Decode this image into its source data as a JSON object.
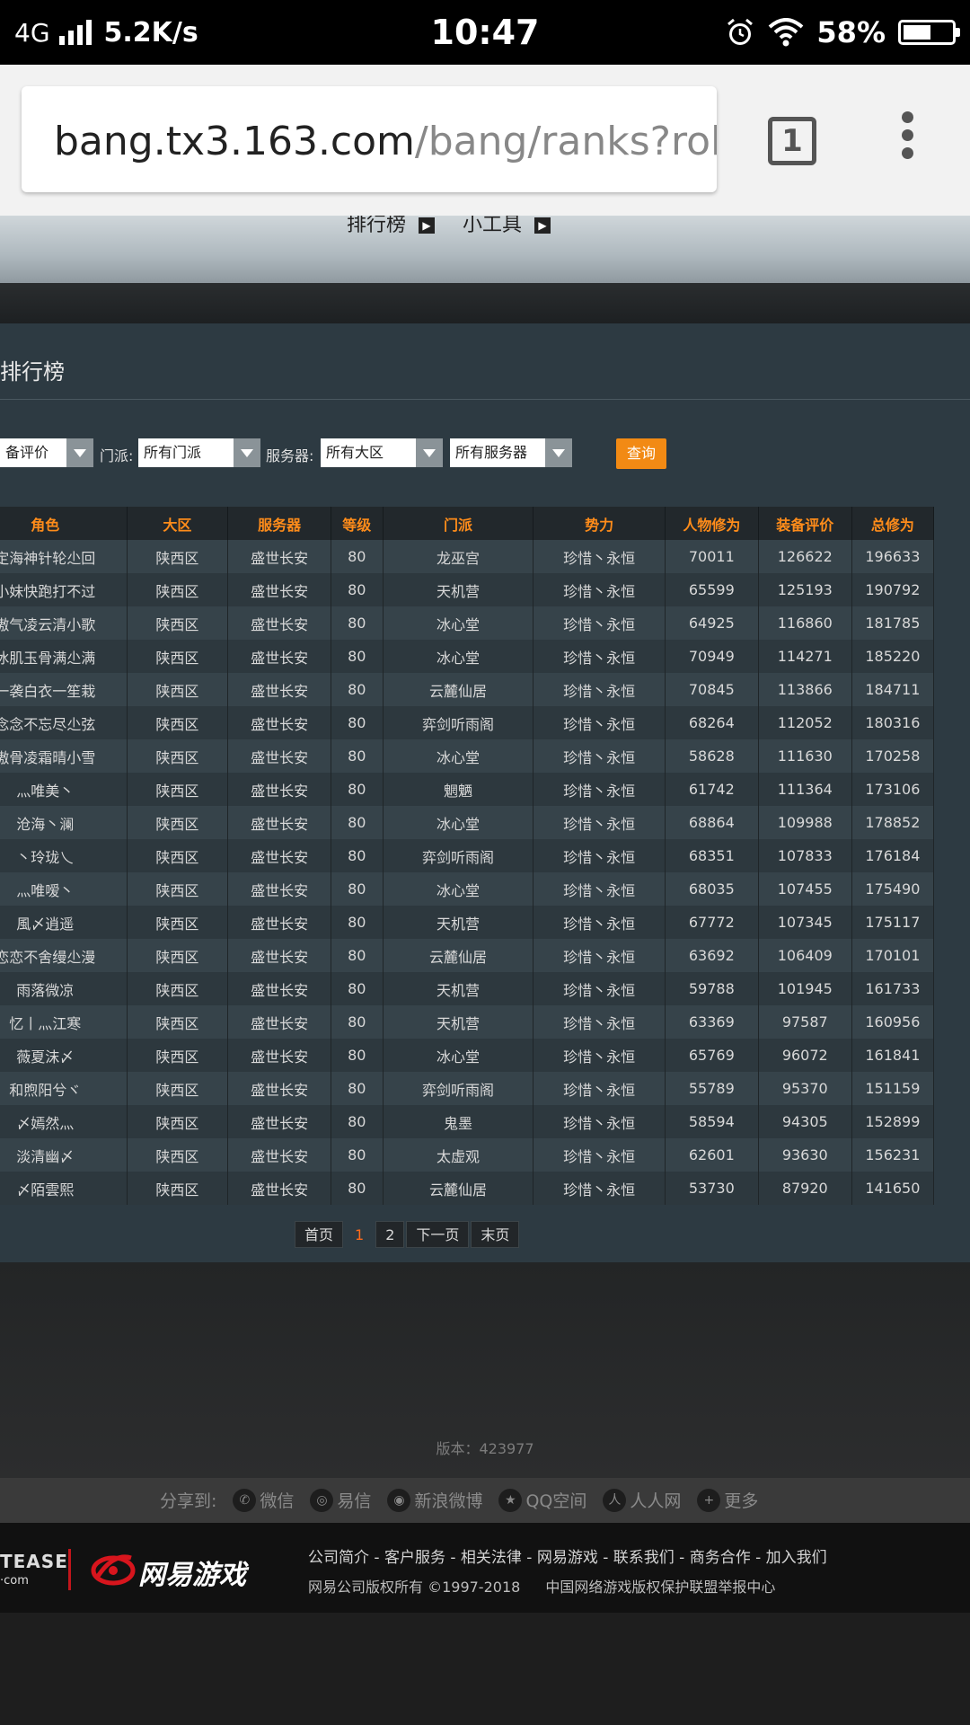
{
  "status_bar": {
    "network": "4G",
    "speed": "5.2K/s",
    "time": "10:47",
    "battery_pct": "58%",
    "battery_level": 0.58
  },
  "browser": {
    "url_host": "bang.tx3.163.com",
    "url_path": "/bang/ranks?role_ic",
    "tab_count": "1"
  },
  "nav": {
    "ranks": "排行榜",
    "tools": "小工具"
  },
  "panel": {
    "title": "排行榜"
  },
  "filters": {
    "sort_value": "备评价",
    "school_label": "门派:",
    "school_value": "所有门派",
    "server_label": "服务器:",
    "region_value": "所有大区",
    "server_value": "所有服务器",
    "query_button": "查询"
  },
  "table": {
    "headers": [
      "角色",
      "大区",
      "服务器",
      "等级",
      "门派",
      "势力",
      "人物修为",
      "装备评价",
      "总修为"
    ],
    "rows": [
      [
        "定海神针轮尐回",
        "陕西区",
        "盛世长安",
        "80",
        "龙巫宫",
        "珍惜丶永恒",
        "70011",
        "126622",
        "196633"
      ],
      [
        "小妹快跑打不过",
        "陕西区",
        "盛世长安",
        "80",
        "天机营",
        "珍惜丶永恒",
        "65599",
        "125193",
        "190792"
      ],
      [
        "傲气凌云清小歌",
        "陕西区",
        "盛世长安",
        "80",
        "冰心堂",
        "珍惜丶永恒",
        "64925",
        "116860",
        "181785"
      ],
      [
        "冰肌玉骨满尐满",
        "陕西区",
        "盛世长安",
        "80",
        "冰心堂",
        "珍惜丶永恒",
        "70949",
        "114271",
        "185220"
      ],
      [
        "一袭白衣一笙栽",
        "陕西区",
        "盛世长安",
        "80",
        "云麓仙居",
        "珍惜丶永恒",
        "70845",
        "113866",
        "184711"
      ],
      [
        "念念不忘尽尐弦",
        "陕西区",
        "盛世长安",
        "80",
        "弈剑听雨阁",
        "珍惜丶永恒",
        "68264",
        "112052",
        "180316"
      ],
      [
        "傲骨凌霜晴小雪",
        "陕西区",
        "盛世长安",
        "80",
        "冰心堂",
        "珍惜丶永恒",
        "58628",
        "111630",
        "170258"
      ],
      [
        "灬唯美丶",
        "陕西区",
        "盛世长安",
        "80",
        "魍魉",
        "珍惜丶永恒",
        "61742",
        "111364",
        "173106"
      ],
      [
        "沧海丶澜",
        "陕西区",
        "盛世长安",
        "80",
        "冰心堂",
        "珍惜丶永恒",
        "68864",
        "109988",
        "178852"
      ],
      [
        "丶玲珑乀",
        "陕西区",
        "盛世长安",
        "80",
        "弈剑听雨阁",
        "珍惜丶永恒",
        "68351",
        "107833",
        "176184"
      ],
      [
        "灬唯嗳丶",
        "陕西区",
        "盛世长安",
        "80",
        "冰心堂",
        "珍惜丶永恒",
        "68035",
        "107455",
        "175490"
      ],
      [
        "風〆逍遥",
        "陕西区",
        "盛世长安",
        "80",
        "天机营",
        "珍惜丶永恒",
        "67772",
        "107345",
        "175117"
      ],
      [
        "恋恋不舍缦尐漫",
        "陕西区",
        "盛世长安",
        "80",
        "云麓仙居",
        "珍惜丶永恒",
        "63692",
        "106409",
        "170101"
      ],
      [
        "雨落微凉",
        "陕西区",
        "盛世长安",
        "80",
        "天机营",
        "珍惜丶永恒",
        "59788",
        "101945",
        "161733"
      ],
      [
        "忆丨灬江寒",
        "陕西区",
        "盛世长安",
        "80",
        "天机营",
        "珍惜丶永恒",
        "63369",
        "97587",
        "160956"
      ],
      [
        "薇夏沫〆",
        "陕西区",
        "盛世长安",
        "80",
        "冰心堂",
        "珍惜丶永恒",
        "65769",
        "96072",
        "161841"
      ],
      [
        "和煦阳兮ヾ",
        "陕西区",
        "盛世长安",
        "80",
        "弈剑听雨阁",
        "珍惜丶永恒",
        "55789",
        "95370",
        "151159"
      ],
      [
        "〆嫣然灬",
        "陕西区",
        "盛世长安",
        "80",
        "鬼墨",
        "珍惜丶永恒",
        "58594",
        "94305",
        "152899"
      ],
      [
        "淡清幽〆",
        "陕西区",
        "盛世长安",
        "80",
        "太虚观",
        "珍惜丶永恒",
        "62601",
        "93630",
        "156231"
      ],
      [
        "〆陌雲熙",
        "陕西区",
        "盛世长安",
        "80",
        "云麓仙居",
        "珍惜丶永恒",
        "53730",
        "87920",
        "141650"
      ]
    ]
  },
  "pager": {
    "first": "首页",
    "current": "1",
    "page2": "2",
    "next": "下一页",
    "last": "末页"
  },
  "version": "版本：423977",
  "share": {
    "label": "分享到:",
    "items": [
      "微信",
      "易信",
      "新浪微博",
      "QQ空间",
      "人人网",
      "更多"
    ]
  },
  "footer": {
    "logo_main": "TEASE",
    "logo_sub": "·com",
    "brand": "网易游戏",
    "links": "公司简介 - 客户服务 - 相关法律 - 网易游戏 - 联系我们 - 商务合作 - 加入我们",
    "copyright": "网易公司版权所有 ©1997-2018",
    "report": "中国网络游戏版权保护联盟举报中心"
  }
}
